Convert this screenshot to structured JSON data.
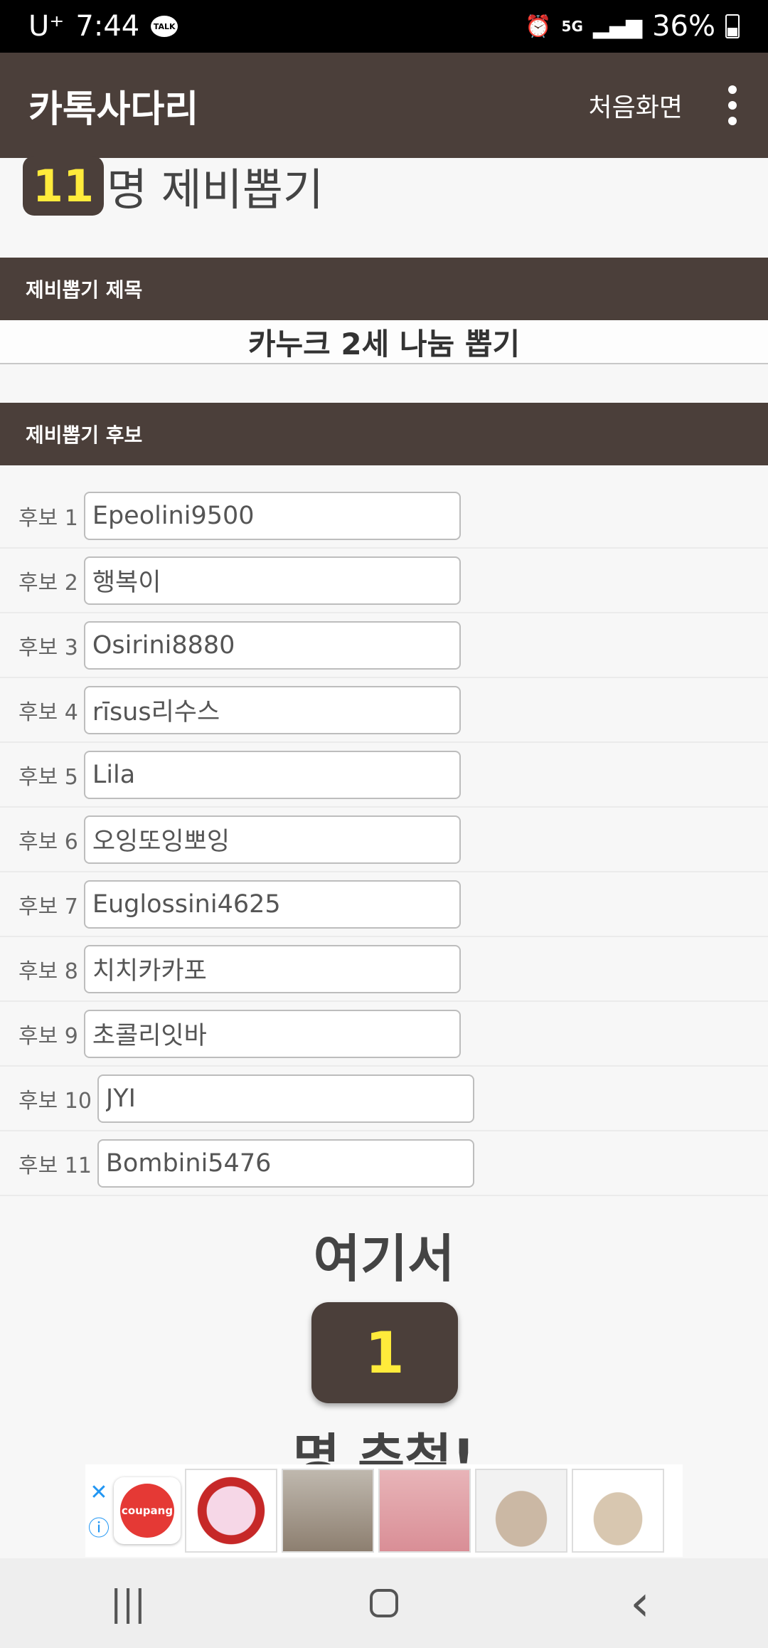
{
  "status_bar": {
    "carrier": "U⁺",
    "time": "7:44",
    "talk_badge": "TALK",
    "network": "5G",
    "battery": "36%"
  },
  "app_bar": {
    "title": "카톡사다리",
    "home_label": "처음화면",
    "menu_icon": "more-vert-icon"
  },
  "header": {
    "count": "11",
    "count_label": "명 제비뽑기"
  },
  "title_section": {
    "heading": "제비뽑기 제목",
    "value": "카누크 2세 나눔 뽑기"
  },
  "candidates_section": {
    "heading": "제비뽑기 후보",
    "items": [
      {
        "label": "후보 1",
        "value": "Epeolini9500"
      },
      {
        "label": "후보 2",
        "value": "행복이"
      },
      {
        "label": "후보 3",
        "value": "Osirini8880"
      },
      {
        "label": "후보 4",
        "value": "rīsus리수스"
      },
      {
        "label": "후보 5",
        "value": "Lila"
      },
      {
        "label": "후보 6",
        "value": "오잉또잉뽀잉"
      },
      {
        "label": "후보 7",
        "value": "Euglossini4625"
      },
      {
        "label": "후보 8",
        "value": "치치카카포"
      },
      {
        "label": "후보 9",
        "value": "초콜리잇바"
      },
      {
        "label": "후보 10",
        "value": "JYI"
      },
      {
        "label": "후보 11",
        "value": "Bombini5476"
      }
    ]
  },
  "draw": {
    "prefix": "여기서",
    "count": "1",
    "suffix": "명 추첨!"
  },
  "ad": {
    "brand": "coupang",
    "close_icon": "close-icon",
    "info_icon": "info-icon"
  },
  "nav": {
    "recents": "|||",
    "back": "‹"
  }
}
